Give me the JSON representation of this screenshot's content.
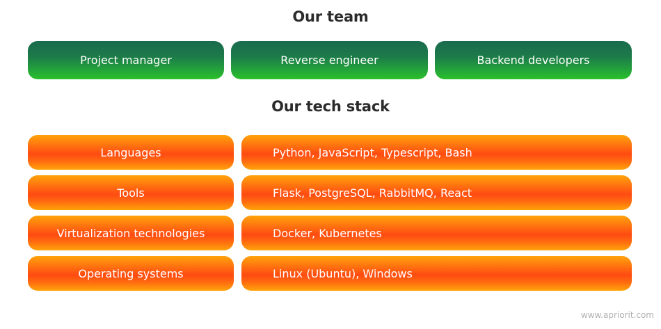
{
  "team": {
    "title": "Our team",
    "members": [
      "Project manager",
      "Reverse engineer",
      "Backend developers"
    ]
  },
  "stack": {
    "title": "Our tech stack",
    "rows": [
      {
        "category": "Languages",
        "items": "Python, JavaScript, Typescript, Bash"
      },
      {
        "category": "Tools",
        "items": "Flask, PostgreSQL, RabbitMQ, React"
      },
      {
        "category": "Virtualization technologies",
        "items": "Docker, Kubernetes"
      },
      {
        "category": "Operating systems",
        "items": "Linux (Ubuntu), Windows"
      }
    ]
  },
  "watermark": "www.apriorit.com",
  "colors": {
    "team_green_top": "#1a6a4e",
    "team_green_bottom": "#2bc12a",
    "stack_orange_edge": "#ffa40a",
    "stack_orange_center": "#ff4b12"
  }
}
